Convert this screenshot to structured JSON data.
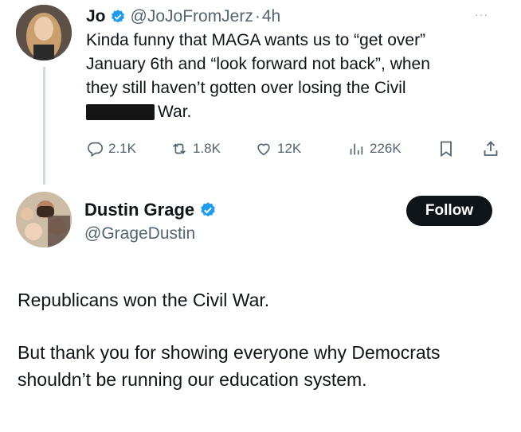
{
  "tweet1": {
    "author_name": "Jo",
    "handle": "@JoJoFromJerz",
    "separator": "·",
    "time": "4h",
    "more_label": "···",
    "text_lines": [
      "Kinda funny that MAGA wants us to “get over”",
      "January 6th and “look forward not back”, when",
      "they still haven’t gotten over losing the Civil",
      "War."
    ],
    "actions": {
      "replies": "2.1K",
      "reposts": "1.8K",
      "likes": "12K",
      "views": "226K"
    }
  },
  "tweet2": {
    "author_name": "Dustin Grage",
    "handle": "@GrageDustin",
    "follow_label": "Follow",
    "paragraphs": [
      "Republicans won the Civil War.",
      "But thank you for showing everyone why Democrats shouldn’t be running our education system."
    ]
  },
  "colors": {
    "verified_blue": "#1d9bf0",
    "follow_bg": "#0f1419",
    "secondary_text": "#536471"
  }
}
